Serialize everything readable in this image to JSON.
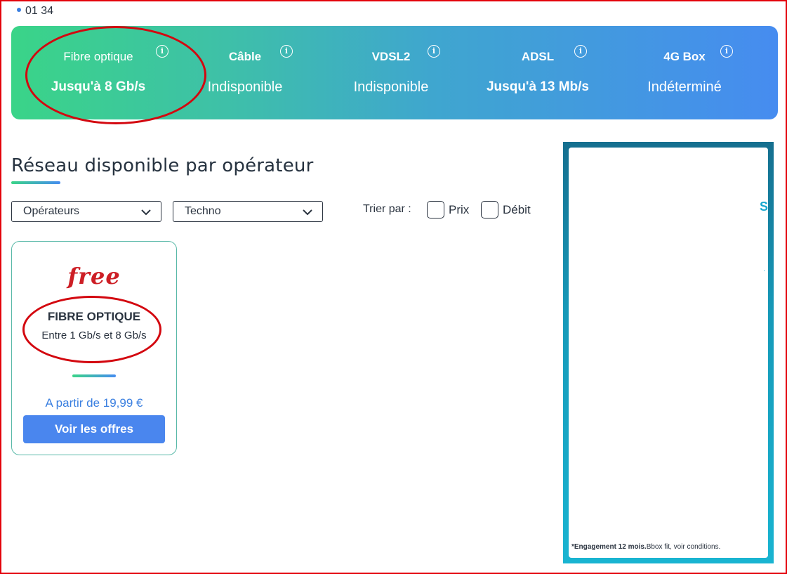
{
  "top_bar": {
    "phone_partial": "01 34"
  },
  "technologies": [
    {
      "name": "Fibre optique",
      "status": "Jusqu'à 8 Gb/s",
      "available": true
    },
    {
      "name": "Câble",
      "status": "Indisponible",
      "available": false
    },
    {
      "name": "VDSL2",
      "status": "Indisponible",
      "available": false
    },
    {
      "name": "ADSL",
      "status": "Jusqu'à 13 Mb/s",
      "available": true
    },
    {
      "name": "4G Box",
      "status": "Indéterminé",
      "available": false
    }
  ],
  "section": {
    "title": "Réseau disponible par opérateur"
  },
  "filters": {
    "operators_select": "Opérateurs",
    "techno_select": "Techno",
    "sort_label": "Trier par :",
    "sort_price": "Prix",
    "sort_speed": "Débit"
  },
  "offers": [
    {
      "brand_logo_text": "free",
      "technology": "FIBRE OPTIQUE",
      "speed_range": "Entre 1 Gb/s et 8 Gb/s",
      "price_text": "A partir de 19,99 €",
      "button_label": "Voir les offres"
    }
  ],
  "ad": {
    "glyph": "S",
    "glyph2": "·",
    "footer_bold": "*Engagement 12 mois.",
    "footer_text": "Bbox fit, voir conditions."
  },
  "colors": {
    "banner_start": "#3ad488",
    "banner_end": "#468cf0",
    "brand_red": "#cd1e25",
    "button_blue": "#4a86ee",
    "annotation_red": "#d3070f"
  }
}
